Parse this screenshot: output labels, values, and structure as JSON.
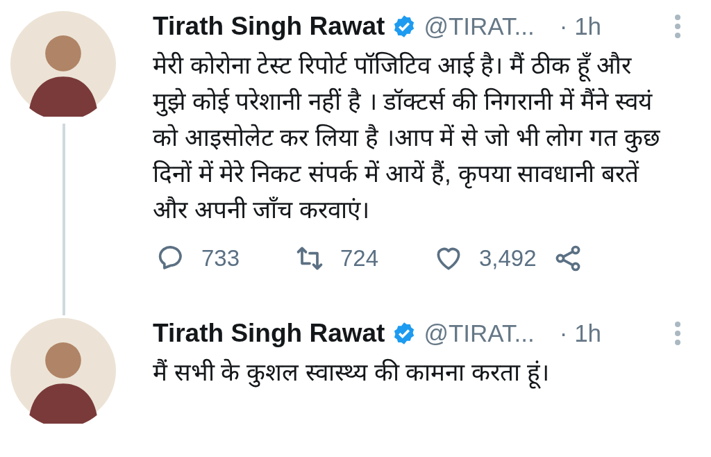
{
  "tweets": [
    {
      "name": "Tirath Singh Rawat",
      "verified": true,
      "handle": "@TIRAT...",
      "time": "· 1h",
      "text": "मेरी कोरोना टेस्ट रिपोर्ट पॉजिटिव आई है। मैं ठीक हूँ और मुझे कोई परेशानी नहीं है । डॉक्टर्स की निगरानी में मैंने स्वयं को आइसोलेट कर लिया है ।आप में से जो भी लोग गत कुछ दिनों में मेरे निकट संपर्क में आयें हैं, कृपया सावधानी बरतें और अपनी जाँच करवाएं।",
      "thread_line": true,
      "actions": {
        "replies": "733",
        "retweets": "724",
        "likes": "3,492"
      }
    },
    {
      "name": "Tirath Singh Rawat",
      "verified": true,
      "handle": "@TIRAT...",
      "time": "· 1h",
      "text": "मैं सभी के कुशल स्वास्थ्य की कामना करता हूं।",
      "thread_line": false
    }
  ]
}
